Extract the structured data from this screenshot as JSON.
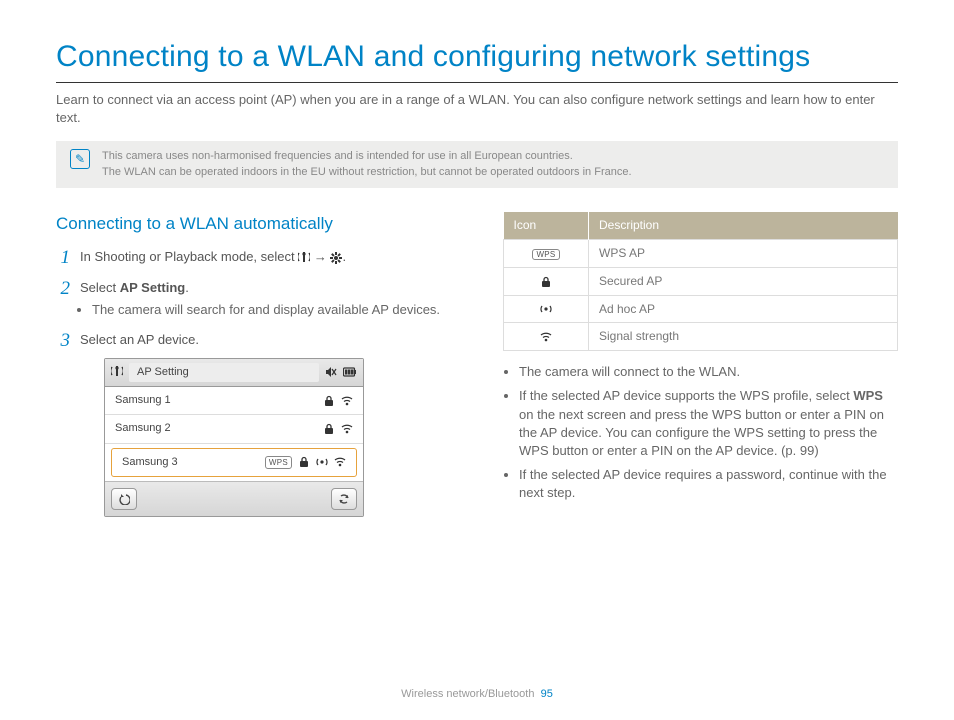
{
  "title": "Connecting to a WLAN and configuring network settings",
  "lead": "Learn to connect via an access point (AP) when you are in a range of a WLAN. You can also configure network settings and learn how to enter text.",
  "note": {
    "line1": "This camera uses non-harmonised frequencies and is intended for use in all European countries.",
    "line2": "The WLAN can be operated indoors in the EU without restriction, but cannot be operated outdoors in France."
  },
  "section_heading": "Connecting to a WLAN automatically",
  "steps": {
    "s1": {
      "num": "1",
      "text_a": "In Shooting or Playback mode, select ",
      "arrow": " → ",
      "period": "."
    },
    "s2": {
      "num": "2",
      "text_a": "Select ",
      "bold": "AP Setting",
      "period": ".",
      "sub": "The camera will search for and display available AP devices."
    },
    "s3": {
      "num": "3",
      "text": "Select an AP device."
    }
  },
  "panel": {
    "title": "AP Setting",
    "rows": [
      {
        "name": "Samsung 1",
        "wps": false,
        "lock": true,
        "adhoc": false,
        "wifi": true,
        "hl": false
      },
      {
        "name": "Samsung 2",
        "wps": false,
        "lock": true,
        "adhoc": false,
        "wifi": true,
        "hl": false
      },
      {
        "name": "Samsung 3",
        "wps": true,
        "lock": true,
        "adhoc": true,
        "wifi": true,
        "hl": true
      }
    ],
    "wps_label": "WPS"
  },
  "icon_table": {
    "head_icon": "Icon",
    "head_desc": "Description",
    "rows": [
      {
        "label": "WPS",
        "type": "wps",
        "desc": "WPS AP"
      },
      {
        "label": "",
        "type": "lock",
        "desc": "Secured AP"
      },
      {
        "label": "",
        "type": "adhoc",
        "desc": "Ad hoc AP"
      },
      {
        "label": "",
        "type": "wifi",
        "desc": "Signal strength"
      }
    ]
  },
  "bullets": {
    "b1": "The camera will connect to the WLAN.",
    "b2a": "If the selected AP device supports the WPS profile, select ",
    "b2_bold": "WPS",
    "b2b": " on the next screen and press the WPS button or enter a PIN on the AP device. You can configure the WPS setting to press the WPS button or enter a PIN on the AP device. (p. 99)",
    "b3": "If the selected AP device requires a password, continue with the next step."
  },
  "footer": {
    "section": "Wireless network/Bluetooth",
    "page": "95"
  }
}
